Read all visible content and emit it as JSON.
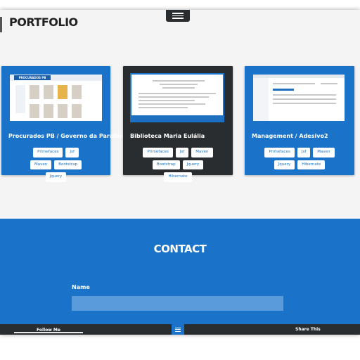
{
  "header": {
    "menu_icon": "hamburger-icon",
    "title": "PORTFOLIO"
  },
  "portfolio": [
    {
      "name": "Procurados PB / Governo da Paraiba",
      "theme": "blue",
      "thumb_text": "PROCURADOS PB",
      "tags": [
        "Primefaces",
        "Jsf",
        "Maven",
        "Bootstrap",
        "Jquery"
      ]
    },
    {
      "name": "Biblioteca Maria Eulália",
      "theme": "dark",
      "tags": [
        "Primefaces",
        "Jsf",
        "Maven",
        "Bootstrap",
        "Jquery",
        "Hibernate"
      ]
    },
    {
      "name": "Management / Adesivo2",
      "theme": "blue",
      "tags": [
        "Primefaces",
        "Jsf",
        "Maven",
        "Jquery",
        "Hibernate"
      ]
    }
  ],
  "contact": {
    "title": "CONTACT",
    "name_label": "Name",
    "name_value": ""
  },
  "footer": {
    "follow_label": "Follow Me",
    "share_label": "Share This",
    "menu_icon": "hamburger-icon"
  },
  "colors": {
    "primary": "#1a73c9",
    "dark": "#2a2d30",
    "background": "#f4f4f4"
  }
}
